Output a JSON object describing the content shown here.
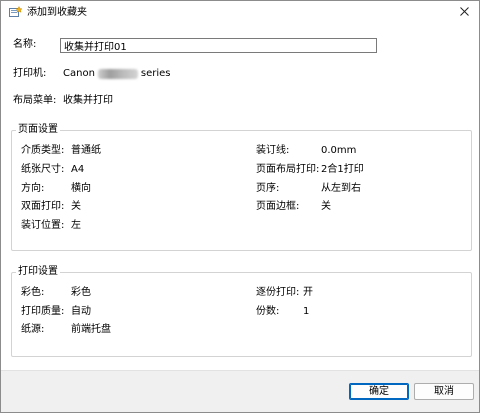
{
  "window": {
    "title": "添加到收藏夹",
    "title_icon": "favorite-add-icon",
    "close_icon": "close-icon"
  },
  "name": {
    "label": "名称:",
    "value": "收集并打印01"
  },
  "printer": {
    "label": "打印机:",
    "value_prefix": "Canon",
    "value_suffix": "series"
  },
  "layout_menu": {
    "label": "布局菜单:",
    "value": "收集并打印"
  },
  "page_settings": {
    "title": "页面设置",
    "media_type": {
      "label": "介质类型:",
      "value": "普通纸"
    },
    "paper_size": {
      "label": "纸张尺寸:",
      "value": "A4"
    },
    "orientation": {
      "label": "方向:",
      "value": "横向"
    },
    "duplex": {
      "label": "双面打印:",
      "value": "关"
    },
    "binding_pos": {
      "label": "装订位置:",
      "value": "左"
    },
    "binding_margin": {
      "label": "装订线:",
      "value": "0.0mm"
    },
    "page_layout": {
      "label": "页面布局打印:",
      "value": "2合1打印"
    },
    "page_order": {
      "label": "页序:",
      "value": "从左到右"
    },
    "page_border": {
      "label": "页面边框:",
      "value": "关"
    }
  },
  "print_settings": {
    "title": "打印设置",
    "color": {
      "label": "彩色:",
      "value": "彩色"
    },
    "quality": {
      "label": "打印质量:",
      "value": "自动"
    },
    "source": {
      "label": "纸源:",
      "value": "前端托盘"
    },
    "collate": {
      "label": "逐份打印:",
      "value": "开"
    },
    "copies": {
      "label": "份数:",
      "value": "1"
    }
  },
  "buttons": {
    "ok": "确定",
    "cancel": "取消"
  }
}
